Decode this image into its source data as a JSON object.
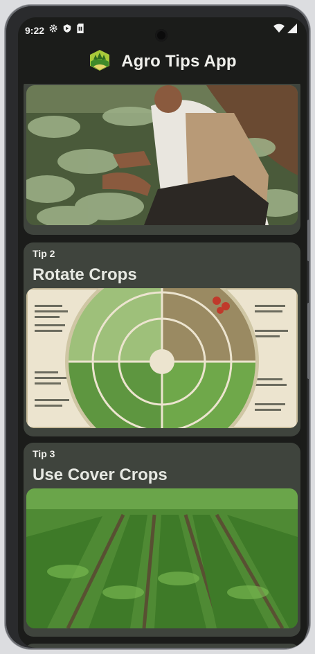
{
  "status": {
    "time": "9:22"
  },
  "app": {
    "title": "Agro Tips App"
  },
  "tips": [
    {
      "number": "Tip 2",
      "title": "Rotate Crops"
    },
    {
      "number": "Tip 3",
      "title": "Use Cover Crops"
    }
  ],
  "colors": {
    "background": "#1b1c1a",
    "card": "#3f443d",
    "text": "#f0f0ec"
  }
}
